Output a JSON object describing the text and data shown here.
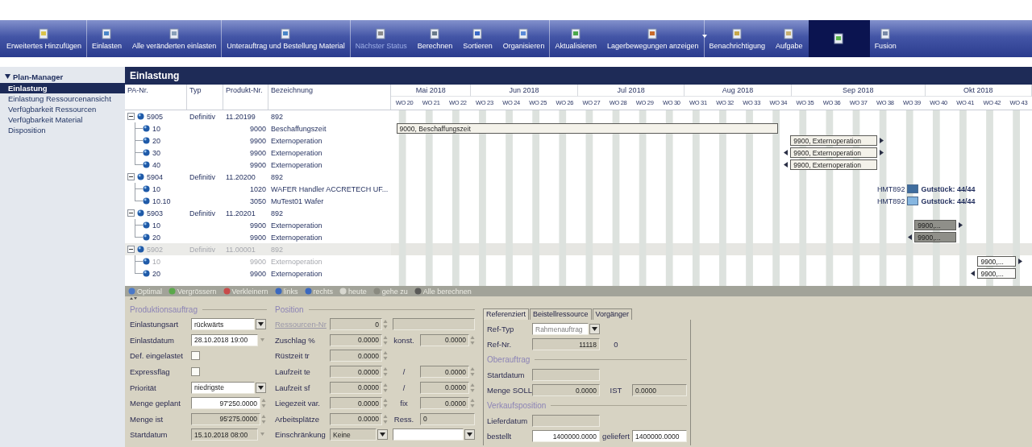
{
  "toolbar": [
    {
      "label": "Erweitertes Hinzufügen",
      "disabled": false,
      "selected": false,
      "dropdown": false,
      "separator_after": true
    },
    {
      "label": "Einlasten",
      "disabled": false,
      "selected": false,
      "dropdown": false,
      "separator_after": false
    },
    {
      "label": "Alle veränderten einlasten",
      "disabled": false,
      "selected": false,
      "dropdown": false,
      "separator_after": true
    },
    {
      "label": "Unterauftrag und Bestellung Material",
      "disabled": false,
      "selected": false,
      "dropdown": false,
      "separator_after": true
    },
    {
      "label": "Nächster Status",
      "disabled": true,
      "selected": false,
      "dropdown": false,
      "separator_after": false
    },
    {
      "label": "Berechnen",
      "disabled": false,
      "selected": false,
      "dropdown": false,
      "separator_after": false
    },
    {
      "label": "Sortieren",
      "disabled": false,
      "selected": false,
      "dropdown": false,
      "separator_after": false
    },
    {
      "label": "Organisieren",
      "disabled": false,
      "selected": false,
      "dropdown": false,
      "separator_after": true
    },
    {
      "label": "Aktualisieren",
      "disabled": false,
      "selected": false,
      "dropdown": false,
      "separator_after": false
    },
    {
      "label": "Lagerbewegungen anzeigen",
      "disabled": false,
      "selected": false,
      "dropdown": true,
      "separator_after": true
    },
    {
      "label": "Benachrichtigung",
      "disabled": false,
      "selected": false,
      "dropdown": false,
      "separator_after": false
    },
    {
      "label": "Aufgabe",
      "disabled": false,
      "selected": false,
      "dropdown": false,
      "separator_after": false
    },
    {
      "disabled": false,
      "selected": true,
      "dropdown": false,
      "separator_after": false
    },
    {
      "label": "Fusion",
      "disabled": false,
      "selected": false,
      "dropdown": false,
      "separator_after": false
    }
  ],
  "sidebar": {
    "title": "Plan-Manager",
    "expanded": true,
    "items": [
      {
        "label": "Einlastung",
        "selected": true
      },
      {
        "label": "Einlastung Ressourcenansicht",
        "selected": false
      },
      {
        "label": "Verfügbarkeit Ressourcen",
        "selected": false
      },
      {
        "label": "Verfügbarkeit Material",
        "selected": false
      },
      {
        "label": "Disposition",
        "selected": false
      }
    ]
  },
  "panel_title": "Einlastung",
  "columns": [
    "PA-Nr.",
    "Typ",
    "Produkt-Nr.",
    "Bezeichnung"
  ],
  "months": [
    "Mai 2018",
    "Jun 2018",
    "Jul 2018",
    "Aug 2018",
    "Sep 2018",
    "Okt 2018"
  ],
  "weeks": [
    "WO 20",
    "WO 21",
    "WO 22",
    "WO 23",
    "WO 24",
    "WO 25",
    "WO 26",
    "WO 27",
    "WO 28",
    "WO 29",
    "WO 30",
    "WO 31",
    "WO 32",
    "WO 33",
    "WO 34",
    "WO 35",
    "WO 36",
    "WO 37",
    "WO 38",
    "WO 39",
    "WO 40",
    "WO 41",
    "WO 42",
    "WO 43"
  ],
  "orders": [
    {
      "id": "5905",
      "type": "Definitiv",
      "product": "11.20199",
      "name": "892",
      "expanded": true,
      "selected": false,
      "dimmed": false,
      "children": [
        {
          "id": "10",
          "product": "9000",
          "name": "Beschaffungszeit",
          "dimmed": false,
          "bar": {
            "kind": "plain",
            "label": "9000, Beschaffungszeit",
            "arrow_left": false,
            "arrow_right": false
          }
        },
        {
          "id": "20",
          "product": "9900",
          "name": "Externoperation",
          "dimmed": false,
          "bar": {
            "kind": "plain",
            "label": "9900, Externoperation",
            "arrow_left": false,
            "arrow_right": true
          }
        },
        {
          "id": "30",
          "product": "9900",
          "name": "Externoperation",
          "dimmed": false,
          "bar": {
            "kind": "plain",
            "label": "9900, Externoperation",
            "arrow_left": true,
            "arrow_right": true
          }
        },
        {
          "id": "40",
          "product": "9900",
          "name": "Externoperation",
          "dimmed": false,
          "bar": {
            "kind": "plain",
            "label": "9900, Externoperation",
            "arrow_left": true,
            "arrow_right": false
          }
        }
      ]
    },
    {
      "id": "5904",
      "type": "Definitiv",
      "product": "11.20200",
      "name": "892",
      "expanded": true,
      "selected": false,
      "dimmed": false,
      "children": [
        {
          "id": "10",
          "product": "1020",
          "name": "WAFER Handler ACCRETECH UF...",
          "dimmed": false,
          "bar": {
            "kind": "resource",
            "resource": "HMT892",
            "note": "Gutstück: 44/44",
            "color": "#3f6d9e"
          }
        },
        {
          "id": "10.10",
          "product": "3050",
          "name": "MuTest01 Wafer",
          "dimmed": false,
          "bar": {
            "kind": "resource",
            "resource": "HMT892",
            "note": "Gutstück: 44/44",
            "color": "#86b6e0"
          }
        }
      ]
    },
    {
      "id": "5903",
      "type": "Definitiv",
      "product": "11.20201",
      "name": "892",
      "expanded": true,
      "selected": false,
      "dimmed": false,
      "children": [
        {
          "id": "10",
          "product": "9900",
          "name": "Externoperation",
          "dimmed": false,
          "bar": {
            "kind": "dark",
            "label": "9900,...",
            "arrow_left": false,
            "arrow_right": true
          }
        },
        {
          "id": "20",
          "product": "9900",
          "name": "Externoperation",
          "dimmed": false,
          "bar": {
            "kind": "dark",
            "label": "9900,...",
            "arrow_left": true,
            "arrow_right": false
          }
        }
      ]
    },
    {
      "id": "5902",
      "type": "Definitiv",
      "product": "11.00001",
      "name": "892",
      "expanded": true,
      "selected": true,
      "dimmed": true,
      "children": [
        {
          "id": "10",
          "product": "9900",
          "name": "Externoperation",
          "dimmed": true,
          "bar": {
            "kind": "white",
            "label": "9900,...",
            "arrow_left": false,
            "arrow_right": true
          }
        },
        {
          "id": "20",
          "product": "9900",
          "name": "Externoperation",
          "dimmed": false,
          "bar": {
            "kind": "white",
            "label": "9900,...",
            "arrow_left": true,
            "arrow_right": false
          }
        }
      ]
    }
  ],
  "gantt_tools": [
    "Optimal",
    "Vergrössern",
    "Verkleinern",
    "links",
    "rechts",
    "heute",
    "gehe zu",
    "Alle berechnen"
  ],
  "production": {
    "title": "Produktionsauftrag",
    "rows": [
      {
        "label": "Einlastungsart",
        "items": [
          {
            "kind": "select",
            "value": "rückwärts",
            "editable": true
          }
        ]
      },
      {
        "label": "Einlastdatum",
        "items": [
          {
            "kind": "date",
            "value": "28.10.2018 19:00",
            "editable": true
          }
        ]
      },
      {
        "label": "Def. eingelastet",
        "items": [
          {
            "kind": "checkbox",
            "checked": false
          }
        ]
      },
      {
        "label": "Expressflag",
        "items": [
          {
            "kind": "checkbox",
            "checked": false
          }
        ]
      },
      {
        "label": "Priorität",
        "items": [
          {
            "kind": "select",
            "value": "niedrigste",
            "editable": true
          }
        ]
      },
      {
        "label": "Menge geplant",
        "items": [
          {
            "kind": "spin",
            "value": "97'250.0000",
            "editable": true
          }
        ]
      },
      {
        "label": "Menge ist",
        "items": [
          {
            "kind": "spin",
            "value": "95'275.0000",
            "editable": false
          }
        ]
      },
      {
        "label": "Startdatum",
        "items": [
          {
            "kind": "date",
            "value": "15.10.2018 08:00",
            "editable": false
          }
        ]
      }
    ]
  },
  "position": {
    "title": "Position",
    "rows": [
      {
        "label": "Ressourcen-Nr",
        "disabled": true,
        "items": [
          {
            "kind": "spin",
            "value": "0",
            "editable": false
          },
          {
            "kind": "text",
            "editable": false
          }
        ]
      },
      {
        "label": "Zuschlag %",
        "disabled": false,
        "items": [
          {
            "kind": "spin",
            "value": "0.0000",
            "editable": false
          },
          {
            "kind": "caption",
            "text": "konst."
          },
          {
            "kind": "spin",
            "value": "0.0000",
            "editable": false
          }
        ]
      },
      {
        "label": "Rüstzeit tr",
        "disabled": false,
        "items": [
          {
            "kind": "spin",
            "value": "0.0000",
            "editable": false
          }
        ]
      },
      {
        "label": "Laufzeit te",
        "disabled": false,
        "items": [
          {
            "kind": "spin",
            "value": "0.0000",
            "editable": false
          },
          {
            "kind": "caption",
            "text": "/"
          },
          {
            "kind": "spin",
            "value": "0.0000",
            "editable": false
          }
        ]
      },
      {
        "label": "Laufzeit sf",
        "disabled": false,
        "items": [
          {
            "kind": "spin",
            "value": "0.0000",
            "editable": false
          },
          {
            "kind": "caption",
            "text": "/"
          },
          {
            "kind": "spin",
            "value": "0.0000",
            "editable": false
          }
        ]
      },
      {
        "label": "Liegezeit var.",
        "disabled": false,
        "items": [
          {
            "kind": "spin",
            "value": "0.0000",
            "editable": false
          },
          {
            "kind": "caption",
            "text": "fix"
          },
          {
            "kind": "spin",
            "value": "0.0000",
            "editable": false
          }
        ]
      },
      {
        "label": "Arbeitsplätze",
        "disabled": false,
        "items": [
          {
            "kind": "spin",
            "value": "0.0000",
            "editable": false
          },
          {
            "kind": "caption",
            "text": "Ress."
          },
          {
            "kind": "text",
            "value": "0",
            "editable": false
          }
        ]
      },
      {
        "label": "Einschränkung",
        "disabled": false,
        "items": [
          {
            "kind": "select",
            "value": "Keine",
            "editable": false
          },
          {
            "kind": "select",
            "editable": true
          }
        ]
      }
    ]
  },
  "reference": {
    "tabs": [
      {
        "label": "Referenziert",
        "selected": true
      },
      {
        "label": "Beistellressource",
        "selected": false
      },
      {
        "label": "Vorgänger",
        "selected": false
      }
    ],
    "rows": [
      {
        "kind": "row",
        "label": "Ref-Typ",
        "items": [
          {
            "kind": "select",
            "value": "Rahmenauftrag",
            "editable": true,
            "disabled": true
          }
        ]
      },
      {
        "kind": "row",
        "label": "Ref-Nr.",
        "items": [
          {
            "kind": "text",
            "value": "11118",
            "editable": false
          },
          {
            "kind": "caption",
            "text": "0"
          }
        ]
      },
      {
        "kind": "section",
        "label": "Oberauftrag"
      },
      {
        "kind": "row",
        "label": "Startdatum",
        "items": [
          {
            "kind": "text",
            "editable": false
          }
        ]
      },
      {
        "kind": "row",
        "label": "Menge SOLL",
        "items": [
          {
            "kind": "text",
            "value": "0.0000",
            "editable": false
          },
          {
            "kind": "caption",
            "text": "IST"
          },
          {
            "kind": "text",
            "value": "0.0000",
            "editable": false
          }
        ]
      },
      {
        "kind": "section",
        "label": "Verkaufsposition"
      },
      {
        "kind": "row",
        "label": "Lieferdatum",
        "items": [
          {
            "kind": "text",
            "editable": false
          }
        ]
      },
      {
        "kind": "row",
        "label": "bestellt",
        "items": [
          {
            "kind": "text",
            "value": "1400000.0000",
            "editable": true
          },
          {
            "kind": "caption",
            "text": "geliefert"
          },
          {
            "kind": "text",
            "value": "1400000.0000",
            "editable": true
          }
        ]
      }
    ]
  }
}
